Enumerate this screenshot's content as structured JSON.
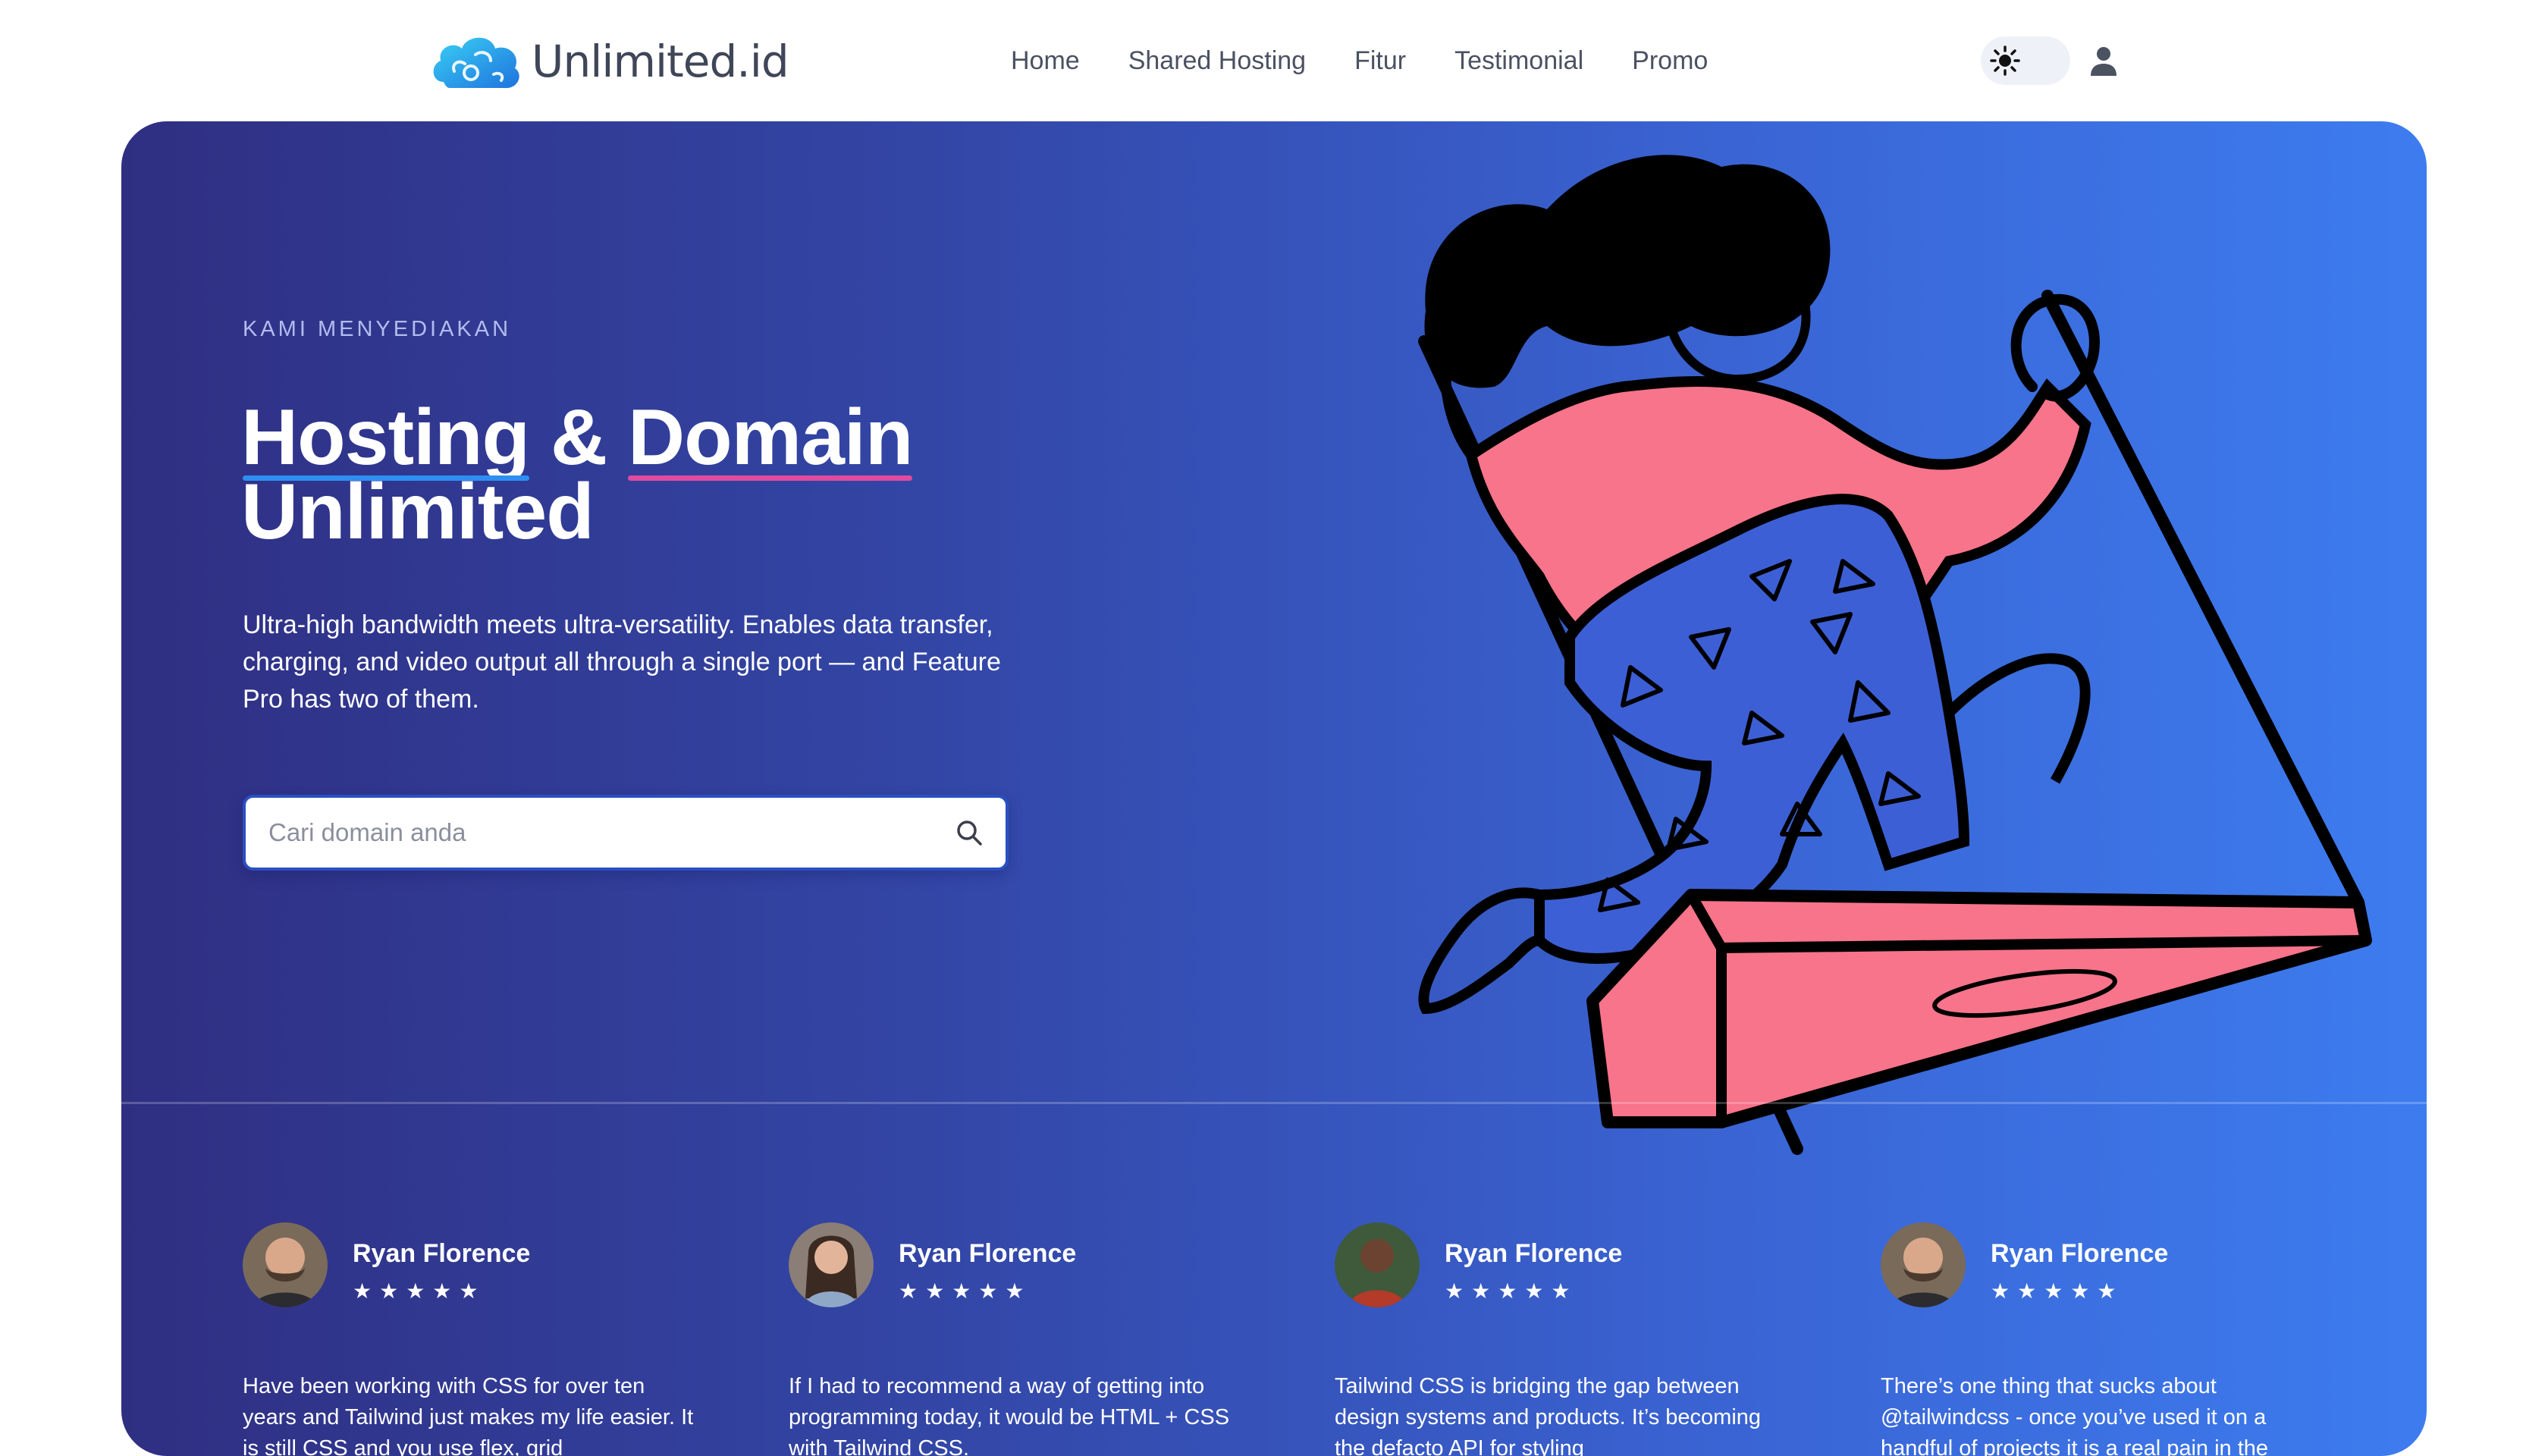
{
  "brand": {
    "name": "Unlimited",
    "tld": ".id"
  },
  "nav": {
    "items": [
      "Home",
      "Shared Hosting",
      "Fitur",
      "Testimonial",
      "Promo"
    ]
  },
  "theme_toggle": {
    "icon": "sun-icon"
  },
  "user_menu": {
    "icon": "user-icon"
  },
  "hero": {
    "eyebrow": "KAMI MENYEDIAKAN",
    "headline": {
      "word1": "Hosting",
      "amp": "&",
      "word2": "Domain",
      "line2": "Unlimited"
    },
    "lead": "Ultra-high bandwidth meets ultra-versatility. Enables data transfer, charging, and video output all through a single port — and Feature Pro has two of them.",
    "search": {
      "placeholder": "Cari domain anda",
      "value": "",
      "icon": "search-icon"
    }
  },
  "testimonials": [
    {
      "name": "Ryan Florence",
      "rating": 5,
      "stars": "★★★★★",
      "quote": "Have been working with CSS for over ten years and Tailwind just makes my life easier. It is still CSS and you use flex, grid"
    },
    {
      "name": "Ryan Florence",
      "rating": 5,
      "stars": "★★★★★",
      "quote": "If I had to recommend a way of getting into programming today, it would be HTML + CSS with Tailwind CSS."
    },
    {
      "name": "Ryan Florence",
      "rating": 5,
      "stars": "★★★★★",
      "quote": "Tailwind CSS is bridging the gap between design systems and products. It’s becoming the defacto API for styling"
    },
    {
      "name": "Ryan Florence",
      "rating": 5,
      "stars": "★★★★★",
      "quote": "There’s one thing that sucks about @tailwindcss - once you’ve used it on a handful of projects it is a real pain in the"
    }
  ],
  "colors": {
    "hero_gradient_start": "#2f2f82",
    "hero_gradient_end": "#3d7cef",
    "headline_underline_1": "#2f8ef2",
    "headline_underline_2": "#e04ba0",
    "illustration_pink": "#f7748b"
  }
}
